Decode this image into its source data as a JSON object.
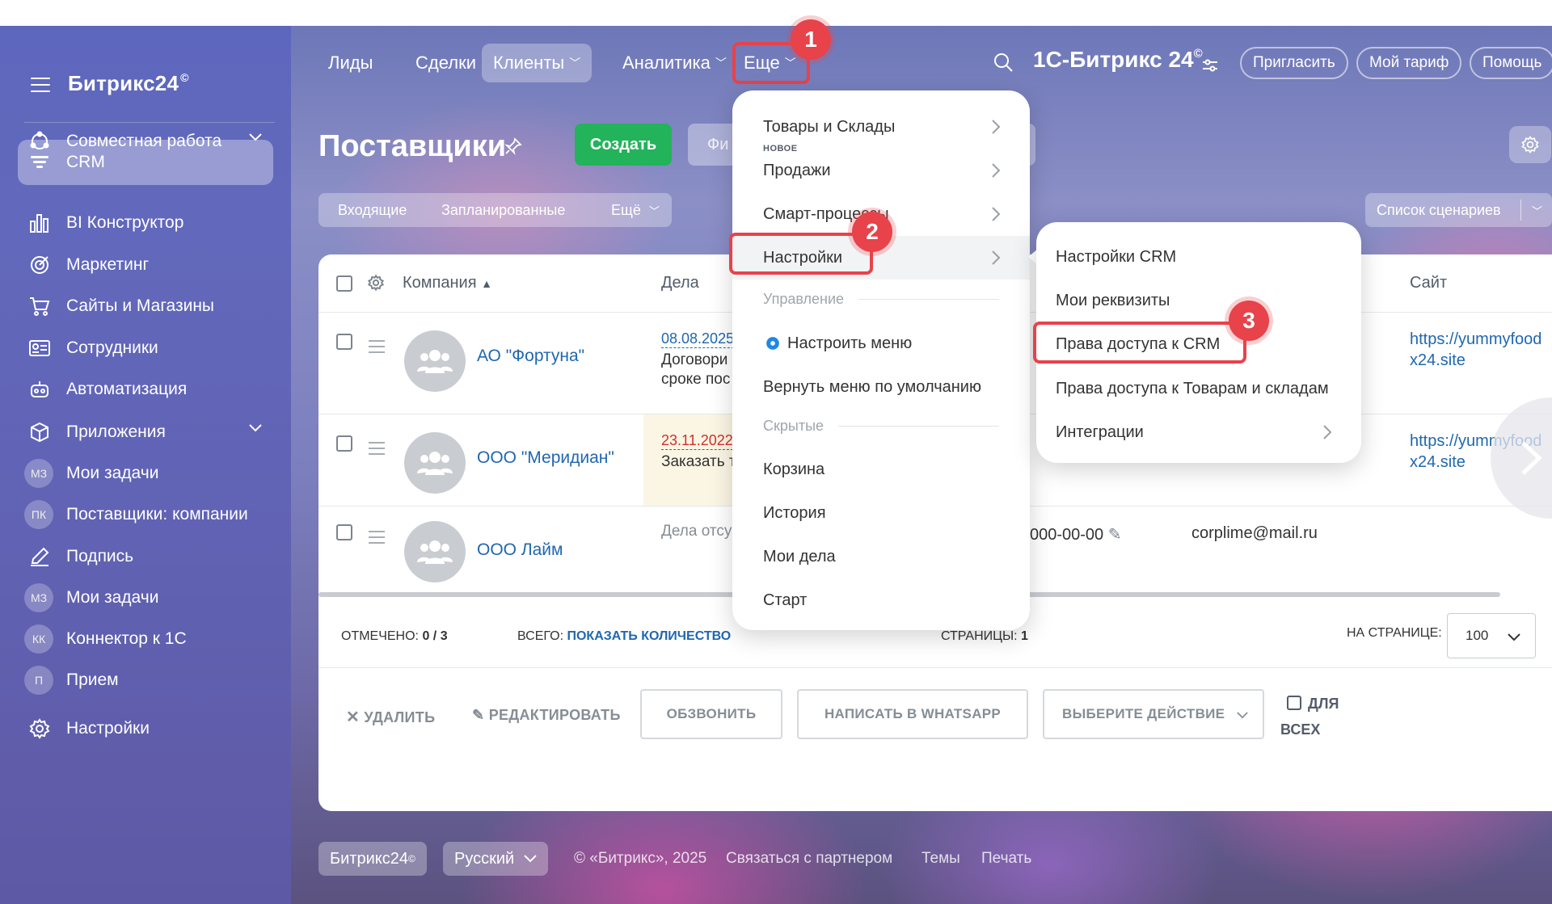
{
  "sidebar": {
    "logo": "Битрикс24",
    "logo_mark": "©",
    "items": [
      {
        "label": "Совместная работа"
      },
      {
        "label": "CRM"
      },
      {
        "label": "BI Конструктор"
      },
      {
        "label": "Маркетинг"
      },
      {
        "label": "Сайты и Магазины"
      },
      {
        "label": "Сотрудники"
      },
      {
        "label": "Автоматизация"
      },
      {
        "label": "Приложения"
      },
      {
        "label": "Мои задачи",
        "badge": "МЗ"
      },
      {
        "label": "Поставщики: компании",
        "badge": "ПК"
      },
      {
        "label": "Подпись"
      },
      {
        "label": "Мои задачи",
        "badge": "МЗ"
      },
      {
        "label": "Коннектор к 1С",
        "badge": "КК"
      },
      {
        "label": "Прием",
        "badge": "П"
      },
      {
        "label": "Настройки"
      }
    ]
  },
  "topnav": {
    "tabs": [
      "Лиды",
      "Сделки",
      "Клиенты",
      "Аналитика",
      "Еще"
    ],
    "portal_name": "1С-Битрикс 24",
    "portal_mark": "©",
    "invite": "Пригласить",
    "tariff": "Мой тариф",
    "help": "Помощь"
  },
  "steps": [
    "1",
    "2",
    "3"
  ],
  "page": {
    "title": "Поставщики",
    "create": "Создать",
    "filter_placeholder": "Фи",
    "subtabs": [
      "Входящие",
      "Запланированные",
      "Ещё"
    ],
    "scenarios": "Список сценариев"
  },
  "grid": {
    "headers": {
      "company": "Компания",
      "deals": "Дела",
      "site": "Сайт"
    },
    "rows": [
      {
        "company": "АО \"Фортуна\"",
        "deal_date": "08.08.2025",
        "deal_text1": "Договори",
        "deal_text2": "сроке пос",
        "site1": "https://yummyfood",
        "site2": "x24.site"
      },
      {
        "company": "ООО \"Меридиан\"",
        "deal_date": "23.11.2022",
        "deal_text1": "Заказать т",
        "site1": "https://yummyfood",
        "site2": "x24.site"
      },
      {
        "company": "ООО Лайм",
        "deal_empty": "Дела отсу",
        "phone": "000-00-00",
        "email": "corplime@mail.ru"
      }
    ],
    "footer": {
      "marked_label": "ОТМЕЧЕНО:",
      "marked_value": "0 / 3",
      "total_label": "ВСЕГО:",
      "total_link": "ПОКАЗАТЬ КОЛИЧЕСТВО",
      "pages_label": "СТРАНИЦЫ:",
      "pages_value": "1",
      "per_page_label": "НА СТРАНИЦЕ:",
      "per_page_value": "100"
    },
    "actions": {
      "delete": "УДАЛИТЬ",
      "edit": "РЕДАКТИРОВАТЬ",
      "call": "ОБЗВОНИТЬ",
      "whatsapp": "НАПИСАТЬ В WHATSAPP",
      "choose": "ВЫБЕРИТЕ ДЕЙСТВИЕ",
      "for_all_1": "ДЛЯ",
      "for_all_2": "ВСЕХ"
    }
  },
  "menu_more": {
    "goods": "Товары и Склады",
    "new_badge": "НОВОЕ",
    "sales": "Продажи",
    "smart": "Смарт-процессы",
    "settings": "Настройки",
    "manage_section": "Управление",
    "configure_menu": "Настроить меню",
    "reset_menu": "Вернуть меню по умолчанию",
    "hidden_section": "Скрытые",
    "hidden_items": [
      "Корзина",
      "История",
      "Мои дела",
      "Старт"
    ]
  },
  "menu_settings": {
    "items": [
      "Настройки CRM",
      "Мои реквизиты",
      "Права доступа к CRM",
      "Права доступа к Товарам и складам",
      "Интеграции"
    ]
  },
  "footer": {
    "brand": "Битрикс24",
    "brand_mark": "©",
    "language": "Русский",
    "copyright": "© «Битрикс», 2025",
    "partner": "Связаться с партнером",
    "themes": "Темы",
    "print": "Печать"
  },
  "colors": {
    "accent_green": "#23b35b",
    "highlight_red": "#e8424a",
    "link_blue": "#2067b0"
  }
}
